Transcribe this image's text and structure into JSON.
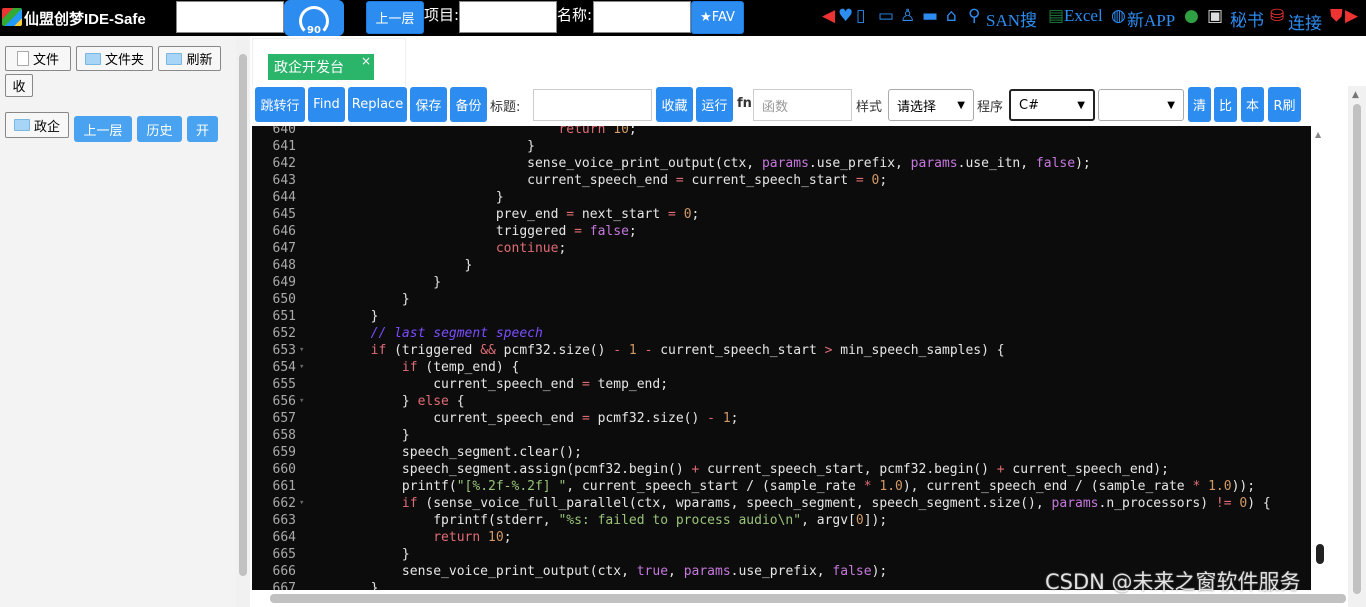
{
  "app": {
    "title": "仙盟创梦IDE-Safe"
  },
  "topbar": {
    "gauge_value": "90",
    "up_button": "上一层",
    "project_label": "项目:",
    "project_value": "",
    "name_label": "名称:",
    "name_value": "",
    "fav_button": "★FAV",
    "links": {
      "san": "SAN搜",
      "excel": "Excel",
      "app": "新APP",
      "secretary": "秘书",
      "connect": "连接"
    }
  },
  "left": {
    "file_button": "文件",
    "folder_button": "文件夹",
    "refresh_button": "刷新",
    "collapse_button": "收",
    "folder_item": "政企",
    "up_button": "上一层",
    "history_button": "历史",
    "open_button": "开"
  },
  "tabs": [
    {
      "label": "政企开发台",
      "close": "×"
    }
  ],
  "toolbar": {
    "goto_line": "跳转行",
    "find": "Find",
    "replace": "Replace",
    "save": "保存",
    "backup": "备份",
    "title_label": "标题:",
    "title_value": "",
    "collect": "收藏",
    "run": "运行",
    "fn_label": "fn",
    "fn_placeholder": "函数",
    "style_label": "样式",
    "style_select": "请选择",
    "program_label": "程序",
    "program_select": "C#",
    "extra_select": "",
    "clear": "清",
    "compare": "比",
    "local": "本",
    "rrefresh": "R刷"
  },
  "editor": {
    "lines": [
      {
        "num": "640",
        "fold": false
      },
      {
        "num": "641",
        "fold": false
      },
      {
        "num": "642",
        "fold": false
      },
      {
        "num": "643",
        "fold": false
      },
      {
        "num": "644",
        "fold": false
      },
      {
        "num": "645",
        "fold": false
      },
      {
        "num": "646",
        "fold": false
      },
      {
        "num": "647",
        "fold": false
      },
      {
        "num": "648",
        "fold": false
      },
      {
        "num": "649",
        "fold": false
      },
      {
        "num": "650",
        "fold": false
      },
      {
        "num": "651",
        "fold": false
      },
      {
        "num": "652",
        "fold": false
      },
      {
        "num": "653",
        "fold": true
      },
      {
        "num": "654",
        "fold": true
      },
      {
        "num": "655",
        "fold": false
      },
      {
        "num": "656",
        "fold": true
      },
      {
        "num": "657",
        "fold": false
      },
      {
        "num": "658",
        "fold": false
      },
      {
        "num": "659",
        "fold": false
      },
      {
        "num": "660",
        "fold": false
      },
      {
        "num": "661",
        "fold": false
      },
      {
        "num": "662",
        "fold": true
      },
      {
        "num": "663",
        "fold": false
      },
      {
        "num": "664",
        "fold": false
      },
      {
        "num": "665",
        "fold": false
      },
      {
        "num": "666",
        "fold": false
      },
      {
        "num": "667",
        "fold": false
      }
    ]
  },
  "watermark": "CSDN @未来之窗软件服务"
}
